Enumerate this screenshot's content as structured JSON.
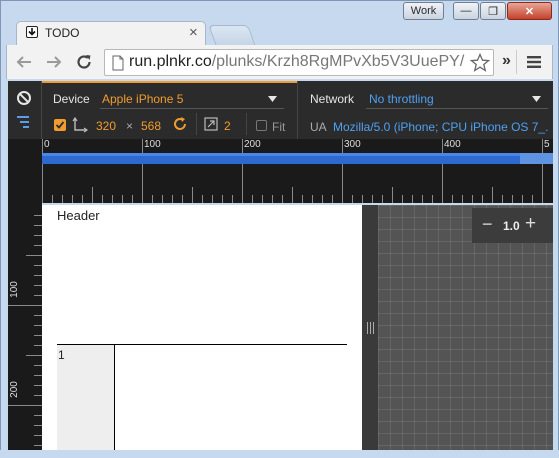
{
  "window": {
    "profile_label": "Work",
    "min_symbol": "—",
    "max_symbol": "❐",
    "close_symbol": "✕"
  },
  "tab": {
    "title": "TODO",
    "close_symbol": "×"
  },
  "toolbar": {
    "url_domain": "run.plnkr.co",
    "url_path": "/plunks/Krzh8RgMPvXb5V3UuePY/",
    "extensions_symbol": "»"
  },
  "emulation": {
    "device_label": "Device",
    "device_value": "Apple iPhone 5",
    "width": "320",
    "times": "×",
    "height": "568",
    "pixel_ratio": "2",
    "fit_label": "Fit",
    "network_label": "Network",
    "network_value": "No throttling",
    "ua_label": "UA",
    "ua_value": "Mozilla/5.0 (iPhone; CPU iPhone OS 7_..."
  },
  "rulers": {
    "top_ticks": [
      "0",
      "100",
      "200",
      "300",
      "400",
      "5"
    ],
    "left_ticks": [
      "100",
      "200"
    ]
  },
  "page": {
    "header_text": "Header",
    "row_number": "1"
  },
  "zoom": {
    "minus": "−",
    "level": "1.0",
    "plus": "+"
  }
}
